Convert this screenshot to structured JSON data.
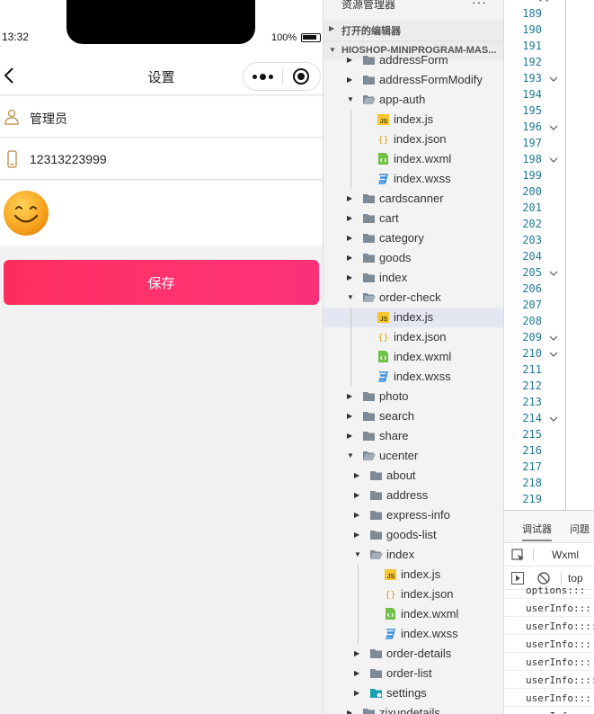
{
  "phone": {
    "status_time": "13:32",
    "battery": "100%",
    "nav_title": "设置",
    "rows": [
      {
        "icon": "user-icon",
        "text": "管理员"
      },
      {
        "icon": "phone-icon",
        "text": "12313223999"
      }
    ],
    "avatar_icon": "smiley-face-icon",
    "save_label": "保存",
    "colors": {
      "save_button": "#ff3371",
      "page_bg": "#f2f2f2"
    }
  },
  "explorer": {
    "title": "资源管理器",
    "more": "···",
    "sections": {
      "open_editors": "打开的编辑器",
      "project": "HIOSHOP-MINIPROGRAM-MAS..."
    },
    "items": [
      {
        "label": "addressForm",
        "type": "folder",
        "expanded": false
      },
      {
        "label": "addressFormModify",
        "type": "folder",
        "expanded": false
      },
      {
        "label": "app-auth",
        "type": "folder",
        "expanded": true
      },
      {
        "label": "index.js",
        "type": "js"
      },
      {
        "label": "index.json",
        "type": "json"
      },
      {
        "label": "index.wxml",
        "type": "wxml"
      },
      {
        "label": "index.wxss",
        "type": "wxss"
      },
      {
        "label": "cardscanner",
        "type": "folder",
        "expanded": false
      },
      {
        "label": "cart",
        "type": "folder",
        "expanded": false
      },
      {
        "label": "category",
        "type": "folder",
        "expanded": false
      },
      {
        "label": "goods",
        "type": "folder",
        "expanded": false
      },
      {
        "label": "index",
        "type": "folder",
        "expanded": false
      },
      {
        "label": "order-check",
        "type": "folder",
        "expanded": true
      },
      {
        "label": "index.js",
        "type": "js",
        "selected": true
      },
      {
        "label": "index.json",
        "type": "json"
      },
      {
        "label": "index.wxml",
        "type": "wxml"
      },
      {
        "label": "index.wxss",
        "type": "wxss"
      },
      {
        "label": "photo",
        "type": "folder",
        "expanded": false
      },
      {
        "label": "search",
        "type": "folder",
        "expanded": false
      },
      {
        "label": "share",
        "type": "folder",
        "expanded": false
      },
      {
        "label": "ucenter",
        "type": "folder",
        "expanded": true
      },
      {
        "label": "about",
        "type": "folder",
        "expanded": false
      },
      {
        "label": "address",
        "type": "folder",
        "expanded": false
      },
      {
        "label": "express-info",
        "type": "folder",
        "expanded": false
      },
      {
        "label": "goods-list",
        "type": "folder",
        "expanded": false
      },
      {
        "label": "index",
        "type": "folder",
        "expanded": true
      },
      {
        "label": "index.js",
        "type": "js"
      },
      {
        "label": "index.json",
        "type": "json"
      },
      {
        "label": "index.wxml",
        "type": "wxml"
      },
      {
        "label": "index.wxss",
        "type": "wxss"
      },
      {
        "label": "order-details",
        "type": "folder",
        "expanded": false
      },
      {
        "label": "order-list",
        "type": "folder",
        "expanded": false
      },
      {
        "label": "settings",
        "type": "folder-special",
        "expanded": false
      },
      {
        "label": "zixundetails",
        "type": "folder",
        "expanded": false
      }
    ]
  },
  "editor": {
    "line_numbers": [
      "189",
      "190",
      "191",
      "192",
      "193",
      "194",
      "195",
      "196",
      "197",
      "198",
      "199",
      "200",
      "201",
      "202",
      "203",
      "204",
      "205",
      "206",
      "207",
      "208",
      "209",
      "210",
      "211",
      "212",
      "213",
      "214",
      "215",
      "216",
      "217",
      "218",
      "219"
    ],
    "fold_lines": [
      "193",
      "196",
      "198",
      "205",
      "209",
      "210",
      "214"
    ]
  },
  "debug": {
    "tabs": [
      "调试器",
      "问题"
    ],
    "active_tab": "调试器",
    "panel_tab": "Wxml",
    "context": "top",
    "console_lines": [
      "options:::",
      "userInfo:::",
      "userInfo::::",
      "userInfo:::",
      "userInfo:::",
      "userInfo::::",
      "userInfo:::",
      "userInfo::::"
    ]
  }
}
